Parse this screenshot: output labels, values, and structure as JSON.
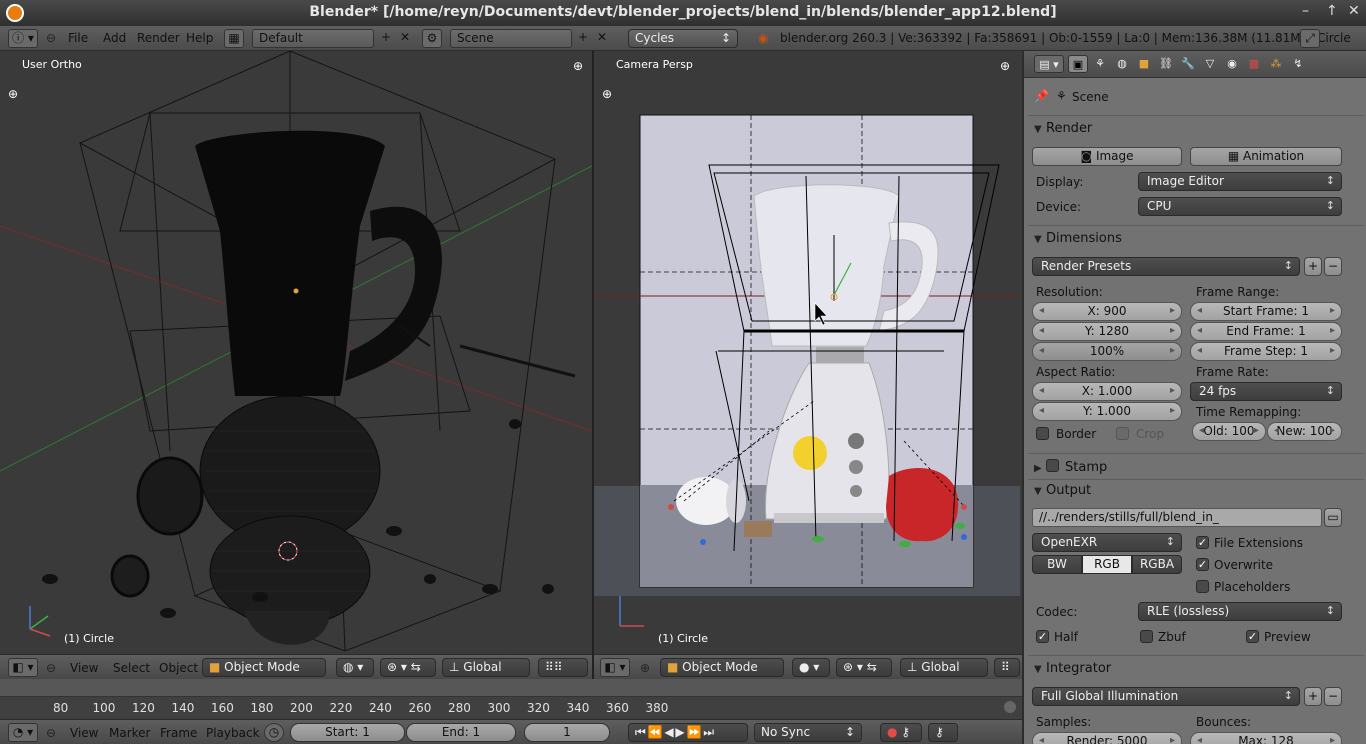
{
  "window": {
    "title": "Blender* [/home/reyn/Documents/devt/blender_projects/blend_in/blends/blender_app12.blend]",
    "minimize": "–",
    "maximize": "↑",
    "close": "✕"
  },
  "infobar": {
    "menus": [
      "File",
      "Add",
      "Render",
      "Help"
    ],
    "layout": "Default",
    "scene": "Scene",
    "engine": "Cycles",
    "stats": "blender.org 260.3 | Ve:363392 | Fa:358691 | Ob:0-1559 | La:0 | Mem:136.38M (11.81M) | Circle"
  },
  "viewport_left": {
    "label": "User Ortho",
    "object": "(1) Circle",
    "menus": [
      "View",
      "Select",
      "Object"
    ],
    "mode": "Object Mode",
    "orientation": "Global"
  },
  "viewport_right": {
    "label": "Camera Persp",
    "object": "(1) Circle",
    "mode": "Object Mode",
    "orientation": "Global"
  },
  "timeline": {
    "ticks": [
      "80",
      "100",
      "120",
      "140",
      "160",
      "180",
      "200",
      "220",
      "240",
      "260",
      "280",
      "300",
      "320",
      "340",
      "360",
      "380"
    ],
    "menus": [
      "View",
      "Marker",
      "Frame",
      "Playback"
    ],
    "start": "Start: 1",
    "end": "End: 1",
    "current": "1",
    "sync": "No Sync"
  },
  "properties": {
    "context": "Scene",
    "render": {
      "title": "Render",
      "image_btn": "Image",
      "animation_btn": "Animation",
      "display_label": "Display:",
      "display_value": "Image Editor",
      "device_label": "Device:",
      "device_value": "CPU"
    },
    "dimensions": {
      "title": "Dimensions",
      "presets": "Render Presets",
      "resolution_label": "Resolution:",
      "res_x": "X: 900",
      "res_y": "Y: 1280",
      "res_pct": "100%",
      "frame_range_label": "Frame Range:",
      "start_frame": "Start Frame: 1",
      "end_frame": "End Frame: 1",
      "frame_step": "Frame Step: 1",
      "aspect_label": "Aspect Ratio:",
      "aspect_x": "X: 1.000",
      "aspect_y": "Y: 1.000",
      "frame_rate_label": "Frame Rate:",
      "frame_rate": "24 fps",
      "remap_label": "Time Remapping:",
      "remap_old": "Old: 100",
      "remap_new": "New: 100",
      "border": "Border",
      "crop": "Crop"
    },
    "stamp": {
      "title": "Stamp"
    },
    "output": {
      "title": "Output",
      "path": "//../renders/stills/full/blend_in_",
      "format": "OpenEXR",
      "file_extensions": "File Extensions",
      "overwrite": "Overwrite",
      "placeholders": "Placeholders",
      "bw": "BW",
      "rgb": "RGB",
      "rgba": "RGBA",
      "codec_label": "Codec:",
      "codec_value": "RLE (lossless)",
      "half": "Half",
      "zbuf": "Zbuf",
      "preview": "Preview"
    },
    "integrator": {
      "title": "Integrator",
      "preset": "Full Global Illumination",
      "samples_label": "Samples:",
      "bounces_label": "Bounces:",
      "render_samples": "Render: 5000",
      "max_bounces": "Max: 128"
    }
  }
}
